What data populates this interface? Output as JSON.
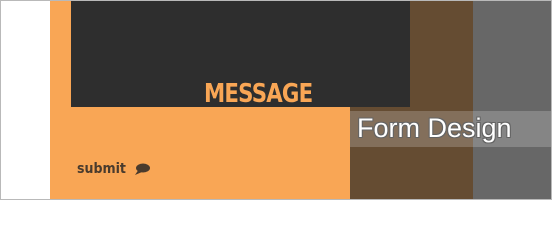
{
  "form": {
    "message_label": "MESSAGE",
    "submit_label": "submit"
  },
  "caption": {
    "title": "Form Design"
  },
  "icons": {
    "submit": "speech-bubble-icon"
  },
  "colors": {
    "orange": "#f9a655",
    "dark": "#2e2e2e",
    "brown": "#654c32",
    "gray": "#676767"
  }
}
